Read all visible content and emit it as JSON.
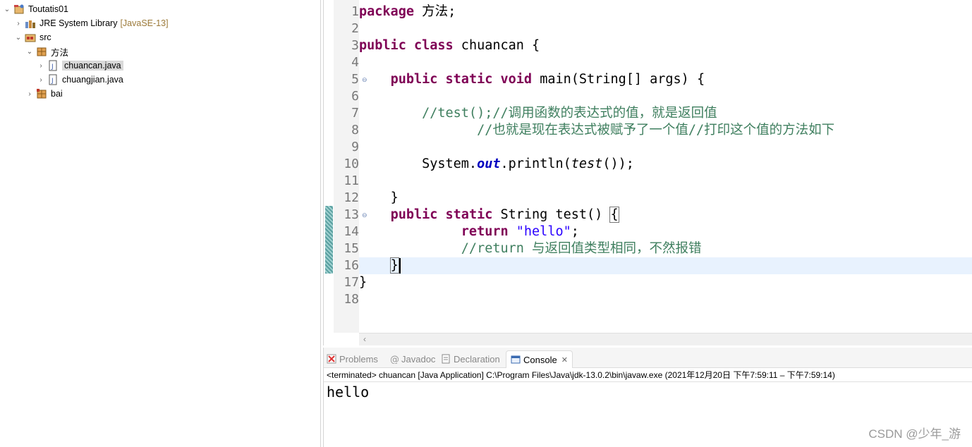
{
  "explorer": {
    "project": "Toutatis01",
    "jre_library": "JRE System Library",
    "jre_version": "[JavaSE-13]",
    "src_folder": "src",
    "package_name": "方法",
    "files": [
      "chuancan.java",
      "chuangjian.java"
    ],
    "other_package": "bai"
  },
  "editor": {
    "line_numbers": [
      "1",
      "2",
      "3",
      "4",
      "5",
      "6",
      "7",
      "8",
      "9",
      "10",
      "11",
      "12",
      "13",
      "14",
      "15",
      "16",
      "17",
      "18"
    ],
    "code": {
      "l1_kw": "package",
      "l1_rest": " 方法;",
      "l3_kw1": "public",
      "l3_kw2": "class",
      "l3_rest": " chuancan {",
      "l5_kw1": "public",
      "l5_kw2": "static",
      "l5_kw3": "void",
      "l5_rest": " main(String[] args) {",
      "l7_cmt": "//test();//调用函数的表达式的值，就是返回值",
      "l8_cmt": "//也就是现在表达式被赋予了一个值//打印这个值的方法如下",
      "l10_a": "System.",
      "l10_field": "out",
      "l10_b": ".println(",
      "l10_call": "test",
      "l10_c": "());",
      "l12": "}",
      "l13_kw1": "public",
      "l13_kw2": "static",
      "l13_rest": " String test() ",
      "l13_brace": "{",
      "l14_kw": "return",
      "l14_str": "\"hello\"",
      "l14_end": ";",
      "l15_cmt": "//return 与返回值类型相同，不然报错",
      "l16": "}",
      "l17": "}"
    }
  },
  "console": {
    "tabs": [
      "Problems",
      "Javadoc",
      "Declaration",
      "Console"
    ],
    "close_glyph": "✕",
    "status": "<terminated> chuancan [Java Application] C:\\Program Files\\Java\\jdk-13.0.2\\bin\\javaw.exe  (2021年12月20日 下午7:59:11 – 下午7:59:14)",
    "output": "hello"
  },
  "watermark": "CSDN @少年_游",
  "icons": {
    "chevron_expanded": "⌄",
    "chevron_collapsed": "›",
    "scroll_left": "‹"
  }
}
